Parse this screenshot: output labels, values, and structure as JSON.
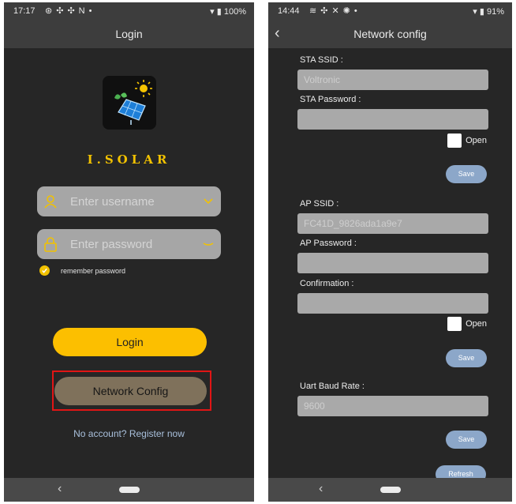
{
  "left": {
    "status": {
      "time": "17:17",
      "icons": [
        "sync-icon",
        "fan-icon",
        "fan-icon",
        "nfc-icon",
        "dot-icon"
      ],
      "battery": "100%"
    },
    "title": "Login",
    "brand": "I.SOLAR",
    "username_placeholder": "Enter username",
    "password_placeholder": "Enter password",
    "remember_label": "remember password",
    "login_label": "Login",
    "network_config_label": "Network Config",
    "register_text": "No account? Register now",
    "colors": {
      "accent": "#fcbf00",
      "background": "#262626",
      "highlight": "#e01515"
    }
  },
  "right": {
    "status": {
      "time": "14:44",
      "icons": [
        "wifi-call-icon",
        "fan-icon",
        "signal-icon",
        "gear-icon",
        "dot-icon"
      ],
      "battery": "91%"
    },
    "title": "Network config",
    "sta_ssid_label": "STA SSID :",
    "sta_ssid_value": "Voltronic",
    "sta_password_label": "STA Password :",
    "sta_password_value": "",
    "open_label_1": "Open",
    "save_label_1": "Save",
    "ap_ssid_label": "AP SSID :",
    "ap_ssid_value": "FC41D_9826ada1a9e7",
    "ap_password_label": "AP Password :",
    "ap_password_value": "",
    "confirmation_label": "Confirmation :",
    "confirmation_value": "",
    "open_label_2": "Open",
    "save_label_2": "Save",
    "uart_label": "Uart Baud Rate :",
    "uart_value": "9600",
    "save_label_3": "Save",
    "refresh_label": "Refresh",
    "colors": {
      "button": "#8ca7c9",
      "field": "#a9a9a9"
    }
  }
}
